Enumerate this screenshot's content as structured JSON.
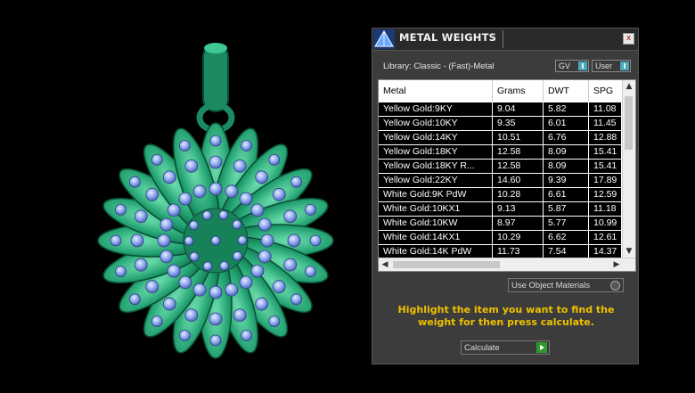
{
  "panel": {
    "title": "METAL WEIGHTS",
    "close_glyph": "x",
    "library_label": "Library: Classic - (Fast)-Metal",
    "toggle_gv": "GV",
    "toggle_user": "User",
    "columns": [
      "Metal",
      "Grams",
      "DWT",
      "SPG"
    ],
    "rows": [
      [
        "Yellow Gold:9KY",
        "9.04",
        "5.82",
        "11.08"
      ],
      [
        "Yellow Gold:10KY",
        "9.35",
        "6.01",
        "11.45"
      ],
      [
        "Yellow Gold:14KY",
        "10.51",
        "6.76",
        "12.88"
      ],
      [
        "Yellow Gold:18KY",
        "12.58",
        "8.09",
        "15.41"
      ],
      [
        "Yellow Gold:18KY R...",
        "12.58",
        "8.09",
        "15.41"
      ],
      [
        "Yellow Gold:22KY",
        "14.60",
        "9.39",
        "17.89"
      ],
      [
        "White Gold:9K PdW",
        "10.28",
        "6.61",
        "12.59"
      ],
      [
        "White Gold:10KX1",
        "9.13",
        "5.87",
        "11.18"
      ],
      [
        "White Gold:10KW",
        "8.97",
        "5.77",
        "10.99"
      ],
      [
        "White Gold:14KX1",
        "10.29",
        "6.62",
        "12.61"
      ],
      [
        "White Gold:14K PdW",
        "11.73",
        "7.54",
        "14.37"
      ]
    ],
    "use_object_materials": "Use Object Materials",
    "instructions": "Highlight the item you want to find the weight for then press calculate.",
    "calculate_label": "Calculate"
  },
  "colors": {
    "pendant_green": "#1f9e6e",
    "gem_blue": "#8ea8f0",
    "instruction_yellow": "#f0c000",
    "panel_bg": "#3c3c3c"
  }
}
